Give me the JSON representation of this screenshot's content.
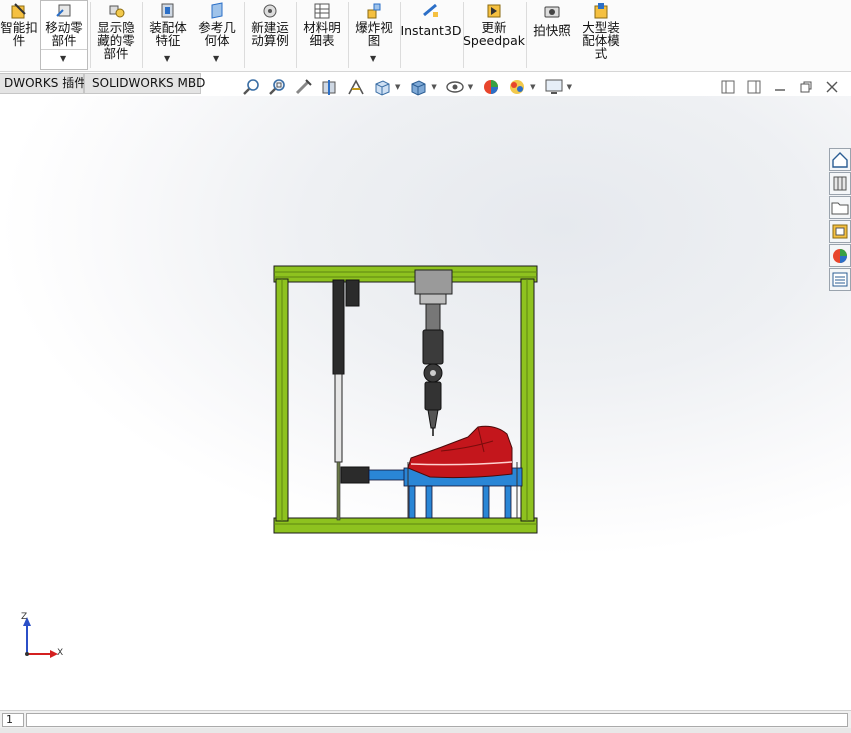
{
  "ribbon": {
    "smart_fastener": "智能扣\n件",
    "move_component": "移动零\n部件",
    "show_hidden": "显示隐\n藏的零\n部件",
    "assembly_features": "装配体\n特征",
    "reference_geometry": "参考几\n何体",
    "new_motion_study": "新建运\n动算例",
    "bill_of_materials": "材料明\n细表",
    "exploded_view": "爆炸视\n图",
    "instant3d": "Instant3D",
    "update_speedpak": "更新\nSpeedpak",
    "snapshot": "拍快照",
    "large_assembly_mode": "大型装\n配体模\n式"
  },
  "tabs": {
    "addins": "DWORKS 插件",
    "mbd": "SOLIDWORKS MBD"
  },
  "triad": {
    "z": "Z",
    "x": "X"
  },
  "statusbar": {
    "field1": "1"
  },
  "colors": {
    "frame_green": "#8ec21f",
    "shoe_red": "#c4161c",
    "base_blue": "#2a86d6"
  }
}
